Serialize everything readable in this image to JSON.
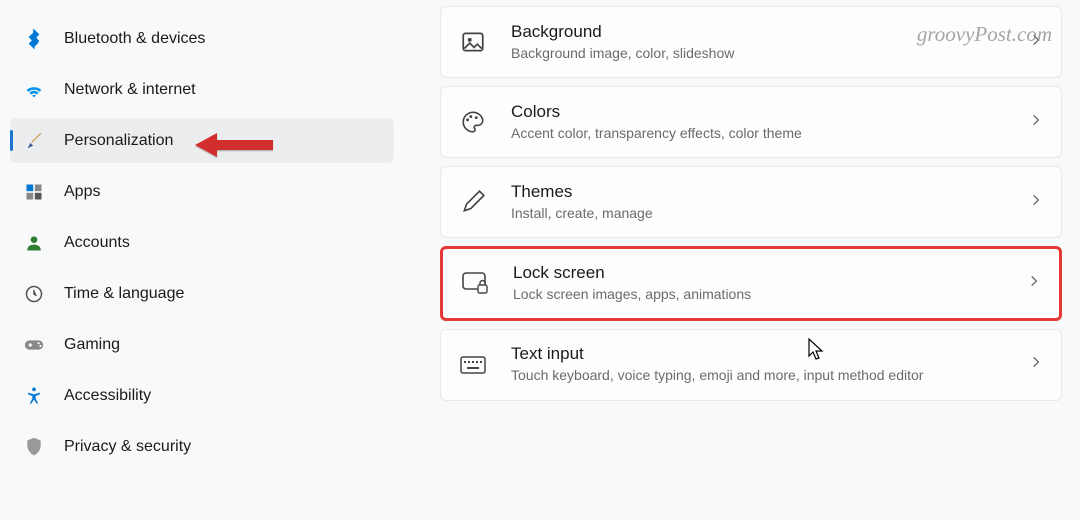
{
  "watermark": "groovyPost.com",
  "sidebar": {
    "items": [
      {
        "label": "Bluetooth & devices"
      },
      {
        "label": "Network & internet"
      },
      {
        "label": "Personalization"
      },
      {
        "label": "Apps"
      },
      {
        "label": "Accounts"
      },
      {
        "label": "Time & language"
      },
      {
        "label": "Gaming"
      },
      {
        "label": "Accessibility"
      },
      {
        "label": "Privacy & security"
      }
    ]
  },
  "main": {
    "cards": [
      {
        "title": "Background",
        "sub": "Background image, color, slideshow"
      },
      {
        "title": "Colors",
        "sub": "Accent color, transparency effects, color theme"
      },
      {
        "title": "Themes",
        "sub": "Install, create, manage"
      },
      {
        "title": "Lock screen",
        "sub": "Lock screen images, apps, animations"
      },
      {
        "title": "Text input",
        "sub": "Touch keyboard, voice typing, emoji and more, input method editor"
      }
    ]
  }
}
